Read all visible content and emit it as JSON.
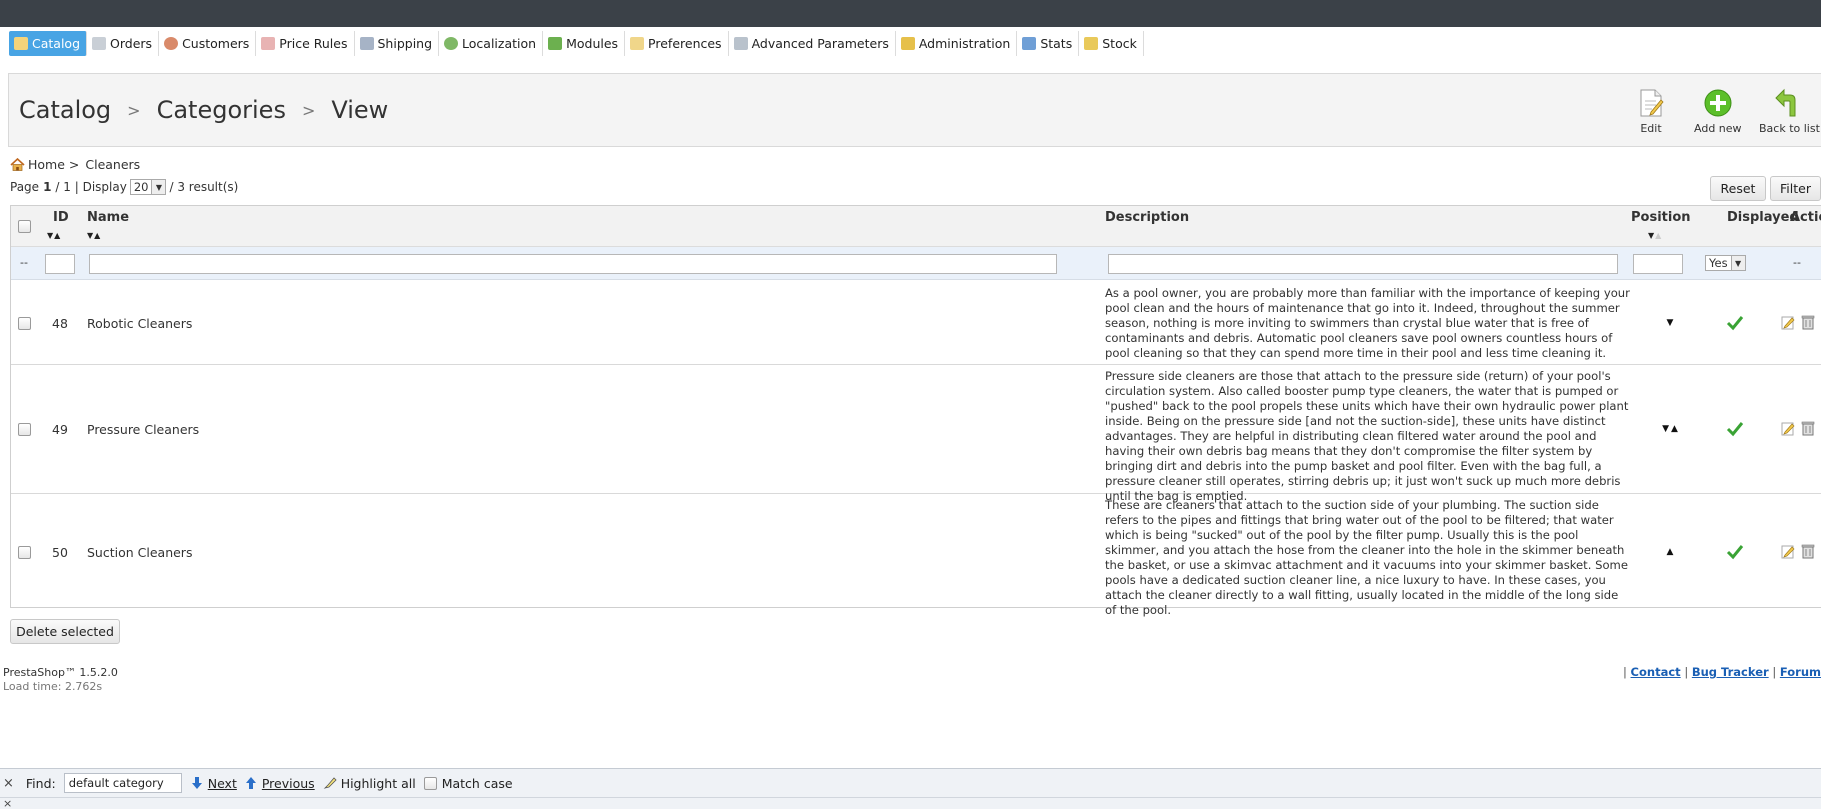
{
  "menu": [
    {
      "label": "Catalog",
      "icon": "catalog-icon",
      "active": true
    },
    {
      "label": "Orders",
      "icon": "cart-icon"
    },
    {
      "label": "Customers",
      "icon": "customer-icon"
    },
    {
      "label": "Price Rules",
      "icon": "price-rules-icon"
    },
    {
      "label": "Shipping",
      "icon": "truck-icon"
    },
    {
      "label": "Localization",
      "icon": "globe-icon"
    },
    {
      "label": "Modules",
      "icon": "puzzle-icon"
    },
    {
      "label": "Preferences",
      "icon": "preferences-icon"
    },
    {
      "label": "Advanced Parameters",
      "icon": "wrench-icon"
    },
    {
      "label": "Administration",
      "icon": "key-icon"
    },
    {
      "label": "Stats",
      "icon": "chart-icon"
    },
    {
      "label": "Stock",
      "icon": "folder-icon"
    }
  ],
  "toolbar": {
    "crumbs": [
      "Catalog",
      "Categories",
      "View"
    ],
    "edit_label": "Edit",
    "add_label": "Add new",
    "back_label": "Back to list"
  },
  "breadcrumb": {
    "home": "Home >",
    "current": "Cleaners"
  },
  "pagination": {
    "page_prefix": "Page",
    "page": "1",
    "of": "/ 1 | Display",
    "display": "20",
    "results": "/ 3 result(s)"
  },
  "buttons": {
    "reset": "Reset",
    "filter": "Filter",
    "delete_selected": "Delete selected"
  },
  "columns": {
    "id": "ID",
    "name": "Name",
    "description": "Description",
    "position": "Position",
    "displayed": "Displayed",
    "actions": "Actions"
  },
  "filter_row": {
    "placeholder_dash": "--",
    "displayed_value": "Yes",
    "actions_dash": "--"
  },
  "rows": [
    {
      "id": "48",
      "name": "Robotic Cleaners",
      "description": "As a pool owner, you are probably more than familiar with the importance of keeping your pool clean and the hours of maintenance that go into it. Indeed, throughout the summer season, nothing is more inviting to swimmers than crystal blue water that is free of contaminants and debris. Automatic pool cleaners save pool owners countless hours of pool cleaning so that they can spend more time in their pool and less time cleaning it.",
      "position": "▼",
      "displayed": true
    },
    {
      "id": "49",
      "name": "Pressure Cleaners",
      "description": "Pressure side cleaners are those that attach to the pressure side (return) of your pool's circulation system. Also called booster pump type cleaners, the water that is pumped or \"pushed\" back to the pool propels these units which have their own hydraulic power plant inside. Being on the pressure side [and not the suction-side], these units have distinct advantages. They are helpful in distributing clean filtered water around the pool and having their own debris bag means that they don't compromise the filter system by bringing dirt and debris into the pump basket and pool filter. Even with the bag full, a pressure cleaner still operates, stirring debris up; it just won't suck up much more debris until the bag is emptied.",
      "position": "▼▲",
      "displayed": true
    },
    {
      "id": "50",
      "name": "Suction Cleaners",
      "description": "These are cleaners that attach to the suction side of your plumbing. The suction side refers to the pipes and fittings that bring water out of the pool to be filtered; that water which is being \"sucked\" out of the pool by the filter pump. Usually this is the pool skimmer, and you attach the hose from the cleaner into the hole in the skimmer beneath the basket, or use a skimvac attachment and it vacuums into your skimmer basket. Some pools have a dedicated suction cleaner line, a nice luxury to have. In these cases, you attach the cleaner directly to a wall fitting, usually located in the middle of the long side of the pool.",
      "position": "▲",
      "displayed": true
    }
  ],
  "footer": {
    "version": "PrestaShop™ 1.5.2.0",
    "load_time": "Load time: 2.762s",
    "links_prefix": "|",
    "contact": "Contact",
    "sep": "|",
    "bug_tracker": "Bug Tracker",
    "forum": "Forum"
  },
  "findbar": {
    "close": "×",
    "find_label": "Find:",
    "query": "default category",
    "next": "Next",
    "previous": "Previous",
    "highlight": "Highlight all",
    "match_case": "Match case"
  },
  "bottom_close": "×",
  "colors": {
    "active_tab": "#48a4e4",
    "check_green": "#3aa335",
    "link_blue": "#1a5fb4"
  }
}
